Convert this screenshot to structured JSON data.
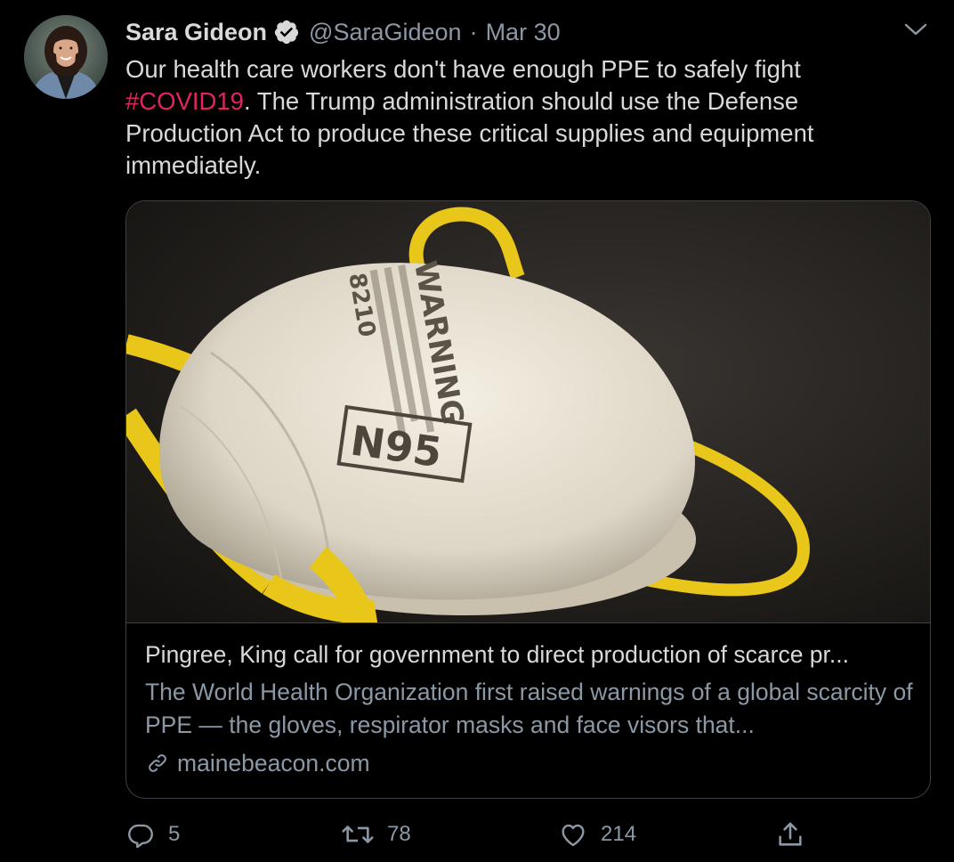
{
  "tweet": {
    "author": {
      "name": "Sara Gideon",
      "handle": "@SaraGideon",
      "verified": true
    },
    "separator": "·",
    "date": "Mar 30",
    "text": {
      "part1": "Our health care workers don't have enough PPE to safely fight ",
      "hashtag": "#COVID19",
      "part2": ". The Trump administration should use the Defense Production Act to produce these critical supplies and equipment immediately."
    },
    "card": {
      "image_mask_label": "N95",
      "image_mask_model": "8210",
      "image_mask_warning": "WARNING",
      "title": "Pingree, King call for government to direct production of scarce pr...",
      "description": "The World Health Organization first raised warnings of a global scarcity of PPE — the gloves, respirator masks and face visors that...",
      "domain": "mainebeacon.com"
    },
    "actions": {
      "replies": "5",
      "retweets": "78",
      "likes": "214"
    }
  },
  "colors": {
    "background": "#000000",
    "text": "#d9d9d9",
    "secondary": "#8b98a5",
    "hashtag": "#e0245e",
    "border": "#3d4148",
    "mask_strap": "#e9c61a"
  },
  "icons": [
    "verified-badge-icon",
    "chevron-down-icon",
    "link-icon",
    "reply-icon",
    "retweet-icon",
    "like-icon",
    "share-icon"
  ]
}
